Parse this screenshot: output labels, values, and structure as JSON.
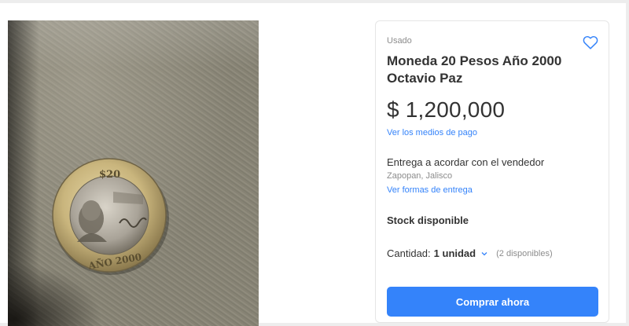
{
  "product": {
    "condition": "Usado",
    "title": "Moneda 20 Pesos Año 2000 Octavio Paz",
    "price": "$ 1,200,000",
    "payment_link": "Ver los medios de pago",
    "delivery": "Entrega a acordar con el vendedor",
    "location": "Zapopan, Jalisco",
    "shipping_link": "Ver formas de entrega",
    "stock": "Stock disponible",
    "quantity_label": "Cantidad:",
    "quantity_value": "1 unidad",
    "available": "(2 disponibles)",
    "buy_button": "Comprar ahora"
  },
  "coin": {
    "denomination": "$20",
    "year": "AÑO 2000"
  },
  "colors": {
    "accent": "#3483fa",
    "text": "#333333",
    "muted": "#8c8c8c"
  },
  "icons": {
    "favorite": "heart-icon",
    "quantity_dropdown": "chevron-down-icon"
  }
}
